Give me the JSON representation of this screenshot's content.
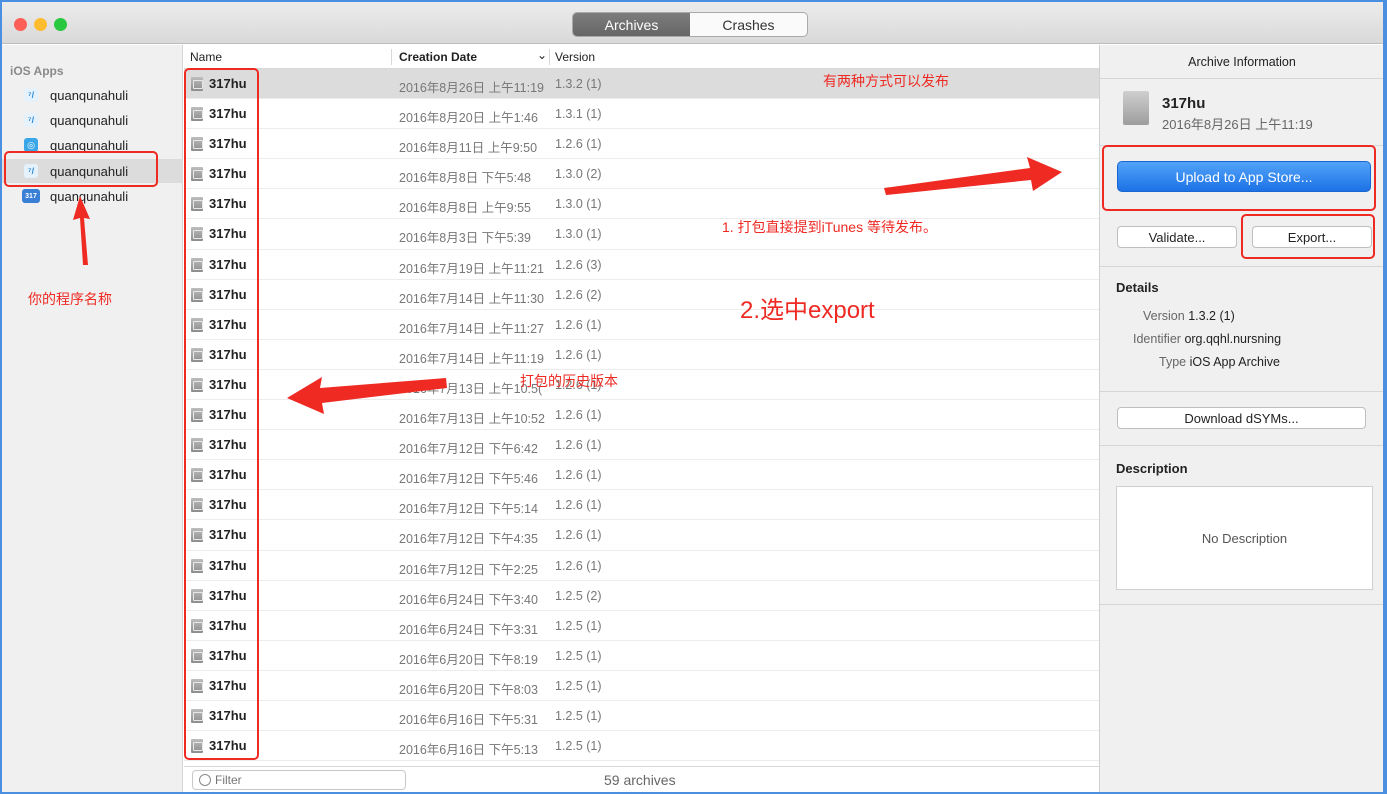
{
  "titlebar": {
    "segments": [
      {
        "label": "Archives",
        "active": true
      },
      {
        "label": "Crashes",
        "active": false
      }
    ],
    "traffic_lights": [
      "#fd5f57",
      "#febc2e",
      "#28c840"
    ]
  },
  "sidebar": {
    "heading": "iOS Apps",
    "apps": [
      {
        "label": "quanqunahuli",
        "icon": "arrow-app-icon",
        "glyph": "⁷/",
        "selected": false
      },
      {
        "label": "quanqunahuli",
        "icon": "arrow-app-icon",
        "glyph": "⁷/",
        "selected": false
      },
      {
        "label": "quanqunahuli",
        "icon": "circle-app-icon",
        "glyph": "◎",
        "selected": false
      },
      {
        "label": "quanqunahuli",
        "icon": "arrow-app-icon",
        "glyph": "⁷/",
        "selected": true
      },
      {
        "label": "quanqunahuli",
        "icon": "317-app-icon",
        "glyph": "317",
        "selected": false
      }
    ]
  },
  "table": {
    "columns": {
      "name": "Name",
      "date": "Creation Date",
      "sort_indicator": "⌄",
      "version": "Version"
    },
    "rows": [
      {
        "name": "317hu",
        "date": "2016年8月26日 上午11:19",
        "version": "1.3.2 (1)",
        "selected": true
      },
      {
        "name": "317hu",
        "date": "2016年8月20日 上午1:46",
        "version": "1.3.1 (1)"
      },
      {
        "name": "317hu",
        "date": "2016年8月11日 上午9:50",
        "version": "1.2.6 (1)"
      },
      {
        "name": "317hu",
        "date": "2016年8月8日 下午5:48",
        "version": "1.3.0 (2)"
      },
      {
        "name": "317hu",
        "date": "2016年8月8日 上午9:55",
        "version": "1.3.0 (1)"
      },
      {
        "name": "317hu",
        "date": "2016年8月3日 下午5:39",
        "version": "1.3.0 (1)"
      },
      {
        "name": "317hu",
        "date": "2016年7月19日 上午11:21",
        "version": "1.2.6 (3)"
      },
      {
        "name": "317hu",
        "date": "2016年7月14日 上午11:30",
        "version": "1.2.6 (2)"
      },
      {
        "name": "317hu",
        "date": "2016年7月14日 上午11:27",
        "version": "1.2.6 (1)"
      },
      {
        "name": "317hu",
        "date": "2016年7月14日 上午11:19",
        "version": "1.2.6 (1)"
      },
      {
        "name": "317hu",
        "date": "2016年7月13日 上午10:5(",
        "version": "1.2.6 (1)"
      },
      {
        "name": "317hu",
        "date": "2016年7月13日 上午10:52",
        "version": "1.2.6 (1)"
      },
      {
        "name": "317hu",
        "date": "2016年7月12日 下午6:42",
        "version": "1.2.6 (1)"
      },
      {
        "name": "317hu",
        "date": "2016年7月12日 下午5:46",
        "version": "1.2.6 (1)"
      },
      {
        "name": "317hu",
        "date": "2016年7月12日 下午5:14",
        "version": "1.2.6 (1)"
      },
      {
        "name": "317hu",
        "date": "2016年7月12日 下午4:35",
        "version": "1.2.6 (1)"
      },
      {
        "name": "317hu",
        "date": "2016年7月12日 下午2:25",
        "version": "1.2.6 (1)"
      },
      {
        "name": "317hu",
        "date": "2016年6月24日 下午3:40",
        "version": "1.2.5 (2)"
      },
      {
        "name": "317hu",
        "date": "2016年6月24日 下午3:31",
        "version": "1.2.5 (1)"
      },
      {
        "name": "317hu",
        "date": "2016年6月20日 下午8:19",
        "version": "1.2.5 (1)"
      },
      {
        "name": "317hu",
        "date": "2016年6月20日 下午8:03",
        "version": "1.2.5 (1)"
      },
      {
        "name": "317hu",
        "date": "2016年6月16日 下午5:31",
        "version": "1.2.5 (1)"
      },
      {
        "name": "317hu",
        "date": "2016年6月16日 下午5:13",
        "version": "1.2.5 (1)"
      }
    ],
    "filter_placeholder": "Filter",
    "count": "59 archives"
  },
  "panel": {
    "title": "Archive Information",
    "archive_name": "317hu",
    "archive_date": "2016年8月26日 上午11:19",
    "upload_label": "Upload to App Store...",
    "validate_label": "Validate...",
    "export_label": "Export...",
    "details_heading": "Details",
    "details": [
      {
        "key": "Version",
        "value": "1.3.2 (1)"
      },
      {
        "key": "Identifier",
        "value": "org.qqhl.nursning"
      },
      {
        "key": "Type",
        "value": "iOS App Archive"
      }
    ],
    "dsyms_label": "Download dSYMs...",
    "description_heading": "Description",
    "description_text": "No Description",
    "upload_color": "#1d72e6"
  },
  "annotations": {
    "two_ways": "有两种方式可以发布",
    "itunes": "1. 打包直接提到iTunes 等待发布。",
    "select_export": "2.选中export",
    "history": "打包的历史版本",
    "app_name": "你的程序名称",
    "color": "#ee2a23"
  }
}
